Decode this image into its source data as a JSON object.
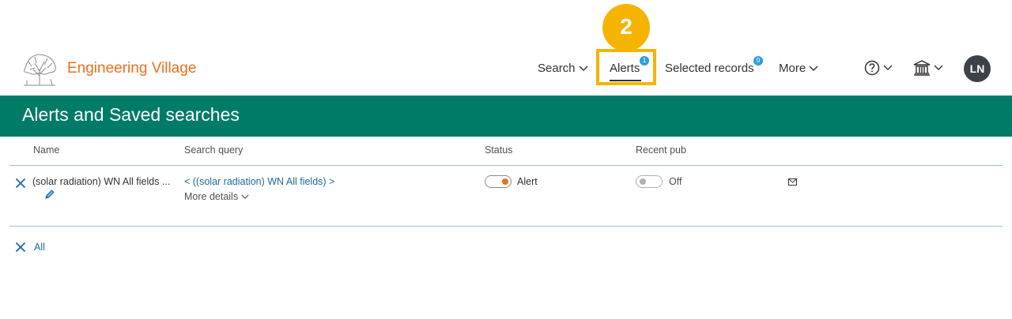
{
  "step_marker": "2",
  "header": {
    "brand": "Engineering Village",
    "nav": {
      "search": "Search",
      "alerts": "Alerts",
      "alerts_count": "1",
      "selected_records": "Selected records",
      "selected_count": "0",
      "more": "More"
    },
    "avatar_initials": "LN"
  },
  "page": {
    "title": "Alerts and Saved searches"
  },
  "table": {
    "headers": {
      "name": "Name",
      "query": "Search query",
      "status": "Status",
      "recent_pub": "Recent pub"
    },
    "rows": [
      {
        "name": "(solar radiation) WN All fields ...",
        "query": "< ((solar radiation) WN All fields) >",
        "more_details": "More details",
        "status": "Alert",
        "recent_pub": "Off"
      }
    ],
    "delete_all": "All"
  },
  "colors": {
    "brand": "#e9711c",
    "band": "#007b68",
    "link": "#1a6a9e",
    "toggle_on": "#e9711c",
    "highlight": "#f5b400"
  }
}
